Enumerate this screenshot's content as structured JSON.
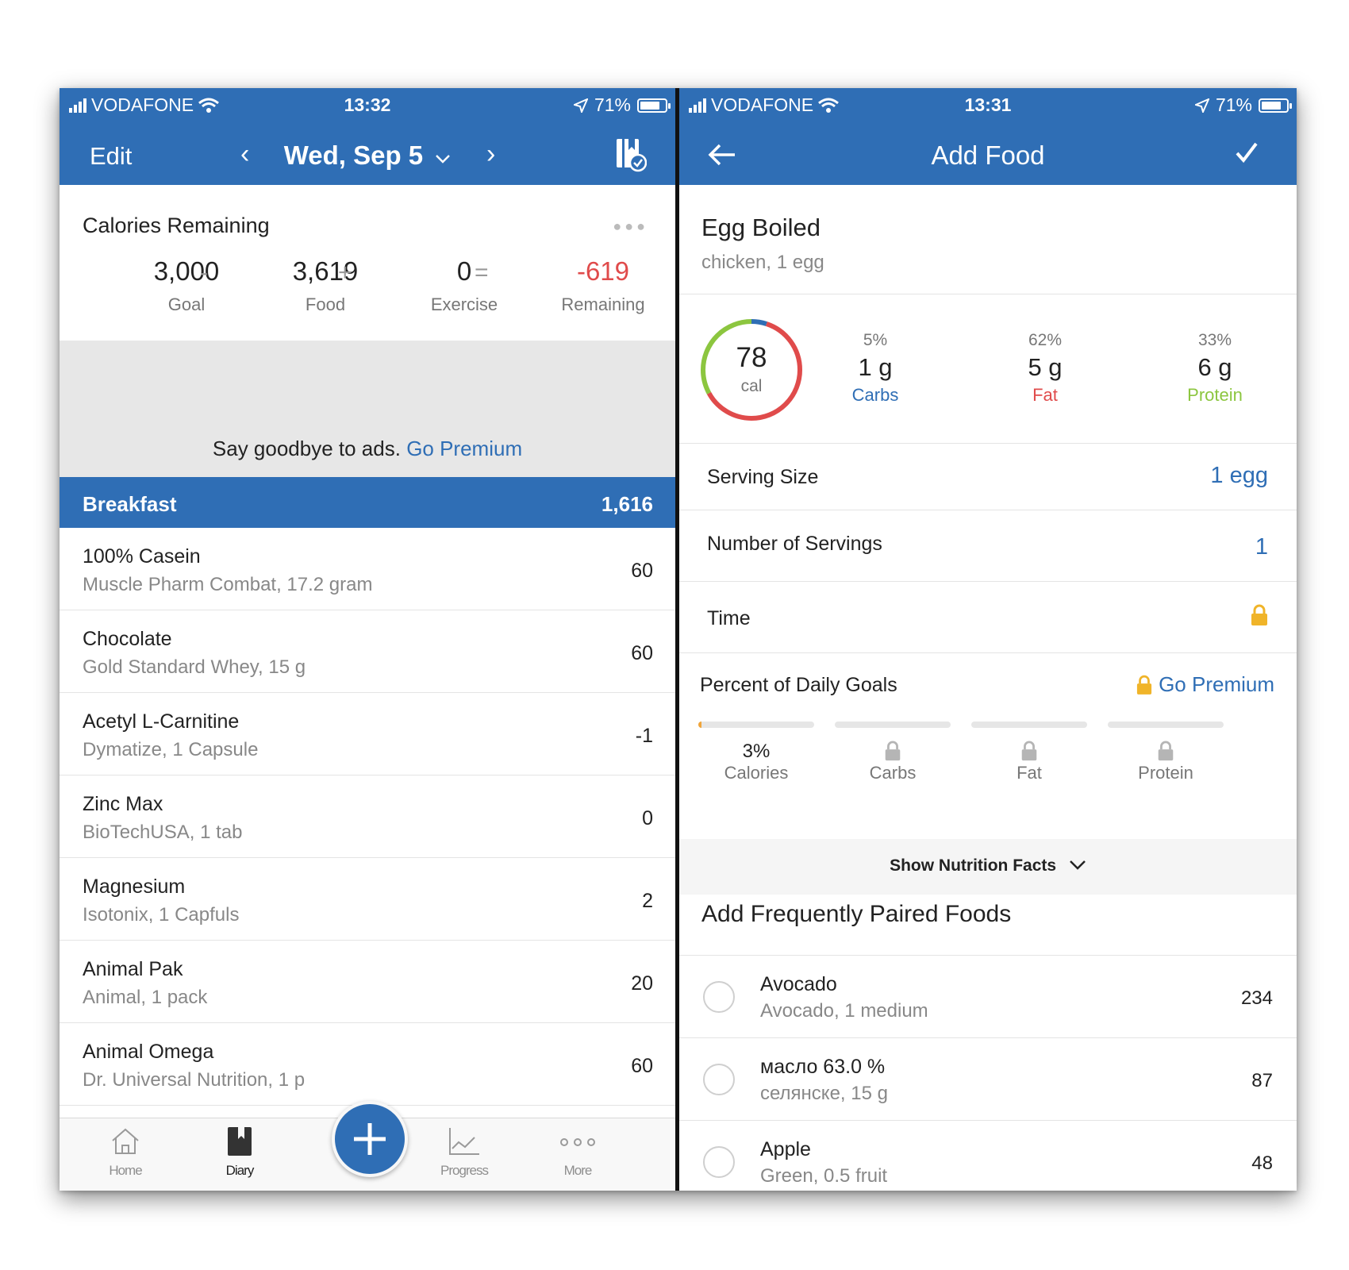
{
  "left": {
    "status": {
      "carrier": "VODAFONE",
      "time": "13:32",
      "battery": "71%"
    },
    "nav": {
      "edit": "Edit",
      "date": "Wed, Sep 5",
      "prev": "‹",
      "next": "›",
      "dropdown": "⌄"
    },
    "calories": {
      "title": "Calories Remaining",
      "goal": {
        "value": "3,000",
        "label": "Goal"
      },
      "food": {
        "value": "3,619",
        "label": "Food"
      },
      "exercise": {
        "value": "0",
        "label": "Exercise"
      },
      "remaining": {
        "value": "-619",
        "label": "Remaining"
      },
      "ops": {
        "minus": "-",
        "plus": "+",
        "equals": "="
      }
    },
    "ad": {
      "text": "Say goodbye to ads.",
      "link": "Go Premium"
    },
    "meal": {
      "name": "Breakfast",
      "calories": "1,616"
    },
    "foods": [
      {
        "name": "100% Casein",
        "desc": "Muscle Pharm Combat, 17.2 gram",
        "cal": "60"
      },
      {
        "name": "Chocolate",
        "desc": "Gold Standard Whey, 15 g",
        "cal": "60"
      },
      {
        "name": "Acetyl L-Carnitine",
        "desc": "Dymatize, 1 Capsule",
        "cal": "-1"
      },
      {
        "name": "Zinc Max",
        "desc": "BioTechUSA, 1 tab",
        "cal": "0"
      },
      {
        "name": "Magnesium",
        "desc": "Isotonix, 1 Capfuls",
        "cal": "2"
      },
      {
        "name": "Animal Pak",
        "desc": "Animal, 1 pack",
        "cal": "20"
      },
      {
        "name": "Animal Omega",
        "desc": "Dr. Universal Nutrition, 1 p",
        "cal": "60"
      }
    ],
    "tabs": {
      "home": "Home",
      "diary": "Diary",
      "progress": "Progress",
      "more": "More"
    }
  },
  "right": {
    "status": {
      "carrier": "VODAFONE",
      "time": "13:31",
      "battery": "71%"
    },
    "nav": {
      "title": "Add Food"
    },
    "food": {
      "name": "Egg Boiled",
      "desc": "chicken, 1 egg"
    },
    "summary": {
      "calories": "78",
      "cal_unit": "cal",
      "macros": [
        {
          "pct": "5%",
          "grams": "1 g",
          "label": "Carbs",
          "color": "#2f6eb5"
        },
        {
          "pct": "62%",
          "grams": "5 g",
          "label": "Fat",
          "color": "#e04b4b"
        },
        {
          "pct": "33%",
          "grams": "6 g",
          "label": "Protein",
          "color": "#8cc63f"
        }
      ]
    },
    "serving_size": {
      "label": "Serving Size",
      "value": "1 egg"
    },
    "servings": {
      "label": "Number of Servings",
      "value": "1"
    },
    "time": {
      "label": "Time"
    },
    "daily_goals": {
      "title": "Percent of Daily Goals",
      "premium": "Go Premium",
      "calories": {
        "value": "3%",
        "label": "Calories",
        "fraction": 0.03
      },
      "carbs": "Carbs",
      "fat": "Fat",
      "protein": "Protein"
    },
    "nutrition_facts": "Show Nutrition Facts",
    "paired": {
      "title": "Add Frequently Paired Foods",
      "items": [
        {
          "name": "Avocado",
          "desc": "Avocado, 1 medium",
          "cal": "234"
        },
        {
          "name": "масло 63.0 %",
          "desc": "селянске, 15 g",
          "cal": "87"
        },
        {
          "name": "Apple",
          "desc": "Green, 0.5 fruit",
          "cal": "48"
        }
      ]
    }
  },
  "colors": {
    "brand": "#2f6eb5",
    "negative": "#e04b4b",
    "lock": "#f0b429"
  }
}
